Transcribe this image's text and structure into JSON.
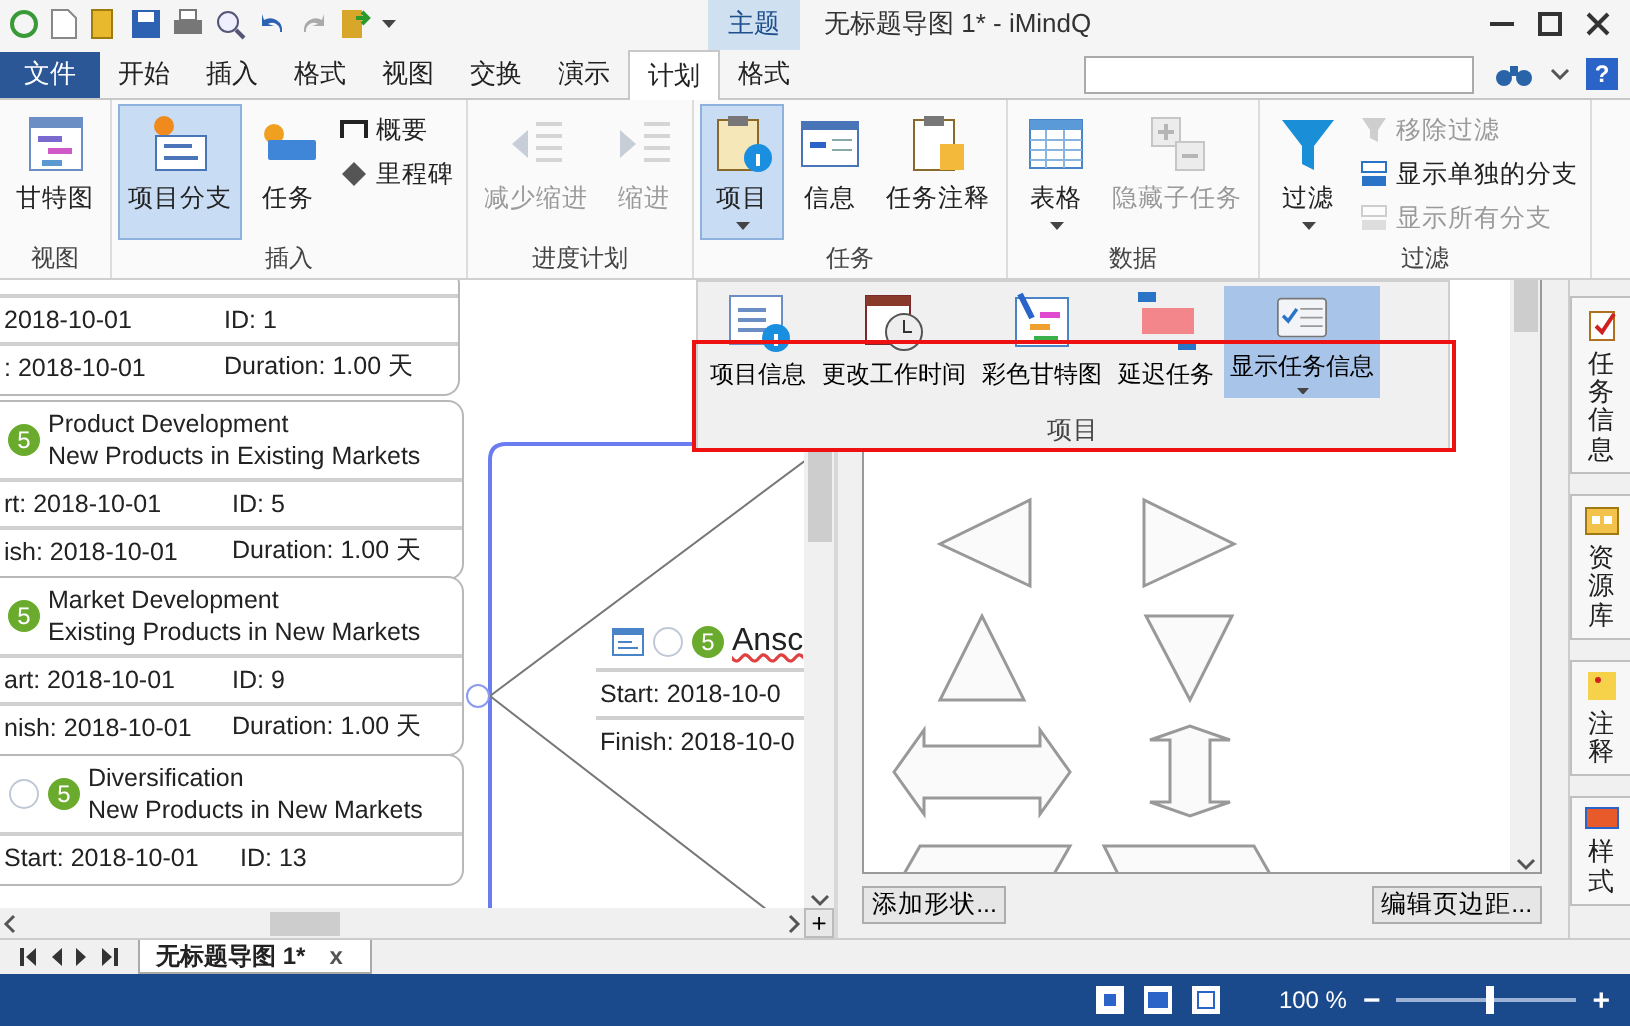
{
  "title_bar": {
    "context_tab": "主题",
    "title": "无标题导图 1* - iMindQ"
  },
  "tabs": [
    {
      "label": "文件",
      "kind": "file",
      "selected": false
    },
    {
      "label": "开始",
      "kind": "tab",
      "selected": false
    },
    {
      "label": "插入",
      "kind": "tab",
      "selected": false
    },
    {
      "label": "格式",
      "kind": "tab",
      "selected": false
    },
    {
      "label": "视图",
      "kind": "tab",
      "selected": false
    },
    {
      "label": "交换",
      "kind": "tab",
      "selected": false
    },
    {
      "label": "演示",
      "kind": "tab",
      "selected": false
    },
    {
      "label": "计划",
      "kind": "tab",
      "selected": true
    },
    {
      "label": "格式",
      "kind": "tab",
      "selected": false
    }
  ],
  "ribbon": [
    {
      "label": "视图",
      "items": [
        {
          "kind": "large",
          "label": "甘特图",
          "selected": false,
          "disabled": false,
          "menu": false
        }
      ]
    },
    {
      "label": "插入",
      "items": [
        {
          "kind": "large",
          "label": "项目分支",
          "selected": true,
          "disabled": false,
          "menu": false
        },
        {
          "kind": "large",
          "label": "任务",
          "selected": false,
          "disabled": false,
          "menu": false
        },
        {
          "kind": "small",
          "label": "概要",
          "selected": false,
          "disabled": false,
          "menu": false
        },
        {
          "kind": "small",
          "label": "里程碑",
          "selected": false,
          "disabled": false,
          "menu": false
        }
      ]
    },
    {
      "label": "进度计划",
      "items": [
        {
          "kind": "large",
          "label": "减少缩进",
          "selected": false,
          "disabled": true,
          "menu": false
        },
        {
          "kind": "large",
          "label": "缩进",
          "selected": false,
          "disabled": true,
          "menu": false
        }
      ]
    },
    {
      "label": "任务",
      "items": [
        {
          "kind": "large",
          "label": "项目",
          "selected": true,
          "disabled": false,
          "menu": true
        },
        {
          "kind": "large",
          "label": "信息",
          "selected": false,
          "disabled": false,
          "menu": false
        },
        {
          "kind": "large",
          "label": "任务注释",
          "selected": false,
          "disabled": false,
          "menu": false
        }
      ]
    },
    {
      "label": "数据",
      "items": [
        {
          "kind": "large",
          "label": "表格",
          "selected": false,
          "disabled": false,
          "menu": true
        },
        {
          "kind": "large",
          "label": "隐藏子任务",
          "selected": false,
          "disabled": true,
          "menu": false
        }
      ]
    },
    {
      "label": "过滤",
      "items": [
        {
          "kind": "large",
          "label": "过滤",
          "selected": false,
          "disabled": false,
          "menu": true
        },
        {
          "kind": "small",
          "label": "移除过滤",
          "selected": false,
          "disabled": true,
          "menu": false
        },
        {
          "kind": "small",
          "label": "显示单独的分支",
          "selected": false,
          "disabled": false,
          "menu": false
        },
        {
          "kind": "small",
          "label": "显示所有分支",
          "selected": false,
          "disabled": true,
          "menu": false
        }
      ]
    }
  ],
  "project_menu": {
    "label": "项目",
    "items": [
      {
        "label": "项目信息",
        "selected": false,
        "menu": false
      },
      {
        "label": "更改工作时间",
        "selected": false,
        "menu": false
      },
      {
        "label": "彩色甘特图",
        "selected": false,
        "menu": false
      },
      {
        "label": "延迟任务",
        "selected": false,
        "menu": false
      },
      {
        "label": "显示任务信息",
        "selected": true,
        "menu": true
      }
    ]
  },
  "help_button": "?",
  "map_nodes": [
    {
      "fields": [
        "2018-10-01",
        "ID: 1",
        ": 2018-10-01",
        "Duration: 1.00 天"
      ]
    },
    {
      "title": [
        "Product Development",
        "New Products in Existing Markets"
      ],
      "priority": "5",
      "completion_circle": false,
      "fields": [
        "rt: 2018-10-01",
        "ID: 5",
        "ish: 2018-10-01",
        "Duration: 1.00 天"
      ]
    },
    {
      "title": [
        "Market Development",
        "Existing Products in New Markets"
      ],
      "priority": "5",
      "completion_circle": false,
      "fields": [
        "art: 2018-10-01",
        "ID: 9",
        "nish: 2018-10-01",
        "Duration: 1.00 天"
      ]
    },
    {
      "title": [
        "Diversification",
        "New Products in New Markets"
      ],
      "priority": "5",
      "completion_circle": true,
      "fields": [
        "Start: 2018-10-01",
        "ID: 13"
      ]
    }
  ],
  "central_topic": {
    "title": "Ansc",
    "misspelled": true,
    "priority": "5",
    "completion_circle": true,
    "fields": [
      "Start: 2018-10-0",
      "Finish: 2018-10-0"
    ]
  },
  "canvas": {
    "add_button": "+"
  },
  "shapes_panel": {
    "buttons": [
      "添加形状...",
      "编辑页边距..."
    ]
  },
  "side_tabs": [
    {
      "label": "任务信息"
    },
    {
      "label": "资源库"
    },
    {
      "label": "注释"
    },
    {
      "label": "样式"
    }
  ],
  "document_tabs": [
    {
      "label": "无标题导图 1*",
      "close": "x",
      "selected": true
    }
  ],
  "status_bar": {
    "zoom": "100 %",
    "zoom_out": "−",
    "zoom_in": "+",
    "zoom_slider": {
      "level": 0.52
    }
  }
}
